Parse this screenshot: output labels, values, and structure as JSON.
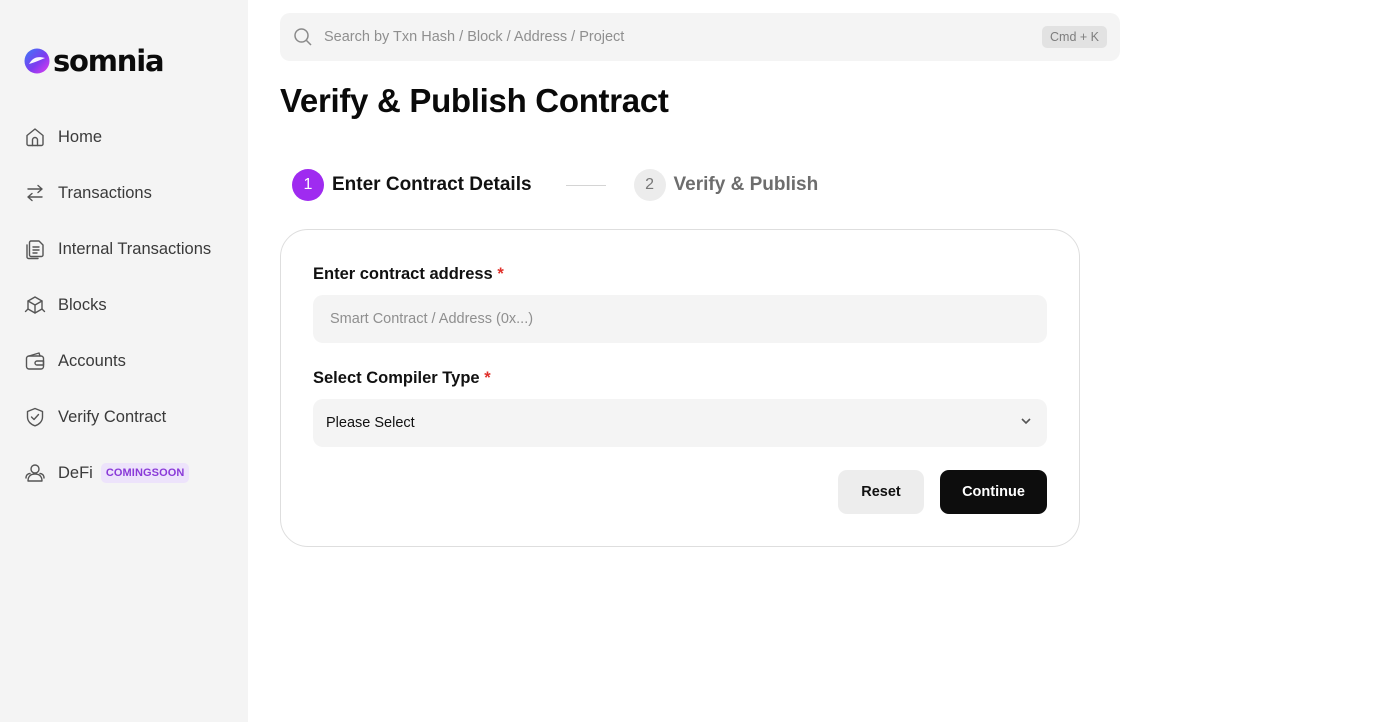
{
  "brand": {
    "name": "somnia",
    "accent": "#9f2bf0",
    "logo_colors": [
      "#3b7bf7",
      "#e23df0",
      "#7d3cf0"
    ]
  },
  "sidebar": {
    "items": [
      {
        "label": "Home",
        "icon": "home-icon"
      },
      {
        "label": "Transactions",
        "icon": "arrows-swap-icon"
      },
      {
        "label": "Internal Transactions",
        "icon": "documents-icon"
      },
      {
        "label": "Blocks",
        "icon": "cube-icon"
      },
      {
        "label": "Accounts",
        "icon": "wallet-icon"
      },
      {
        "label": "Verify Contract",
        "icon": "shield-check-icon"
      },
      {
        "label": "DeFi",
        "icon": "defi-icon",
        "badge": "COMINGSOON"
      }
    ]
  },
  "search": {
    "placeholder": "Search by Txn Hash / Block / Address / Project",
    "shortcut": "Cmd + K"
  },
  "page": {
    "title": "Verify & Publish Contract"
  },
  "steps": [
    {
      "number": "1",
      "label": "Enter Contract Details",
      "state": "active"
    },
    {
      "number": "2",
      "label": "Verify & Publish",
      "state": "inactive"
    }
  ],
  "form": {
    "address": {
      "label": "Enter contract address",
      "required_mark": "*",
      "placeholder": "Smart Contract / Address (0x...)",
      "value": ""
    },
    "compiler": {
      "label": "Select Compiler Type",
      "required_mark": "*",
      "value": "Please Select"
    },
    "reset_label": "Reset",
    "continue_label": "Continue"
  }
}
